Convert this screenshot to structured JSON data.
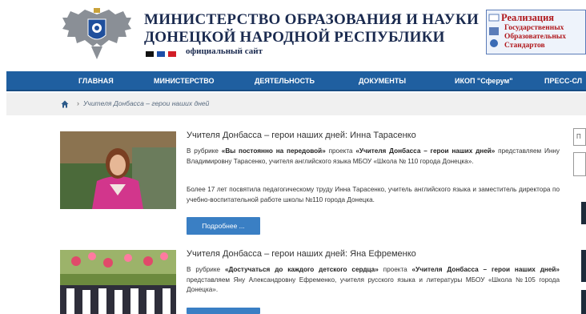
{
  "header": {
    "title_line1": "МИНИСТЕРСТВО ОБРАЗОВАНИЯ И НАУКИ",
    "title_line2": "ДОНЕЦКОЙ НАРОДНОЙ РЕСПУБЛИКИ",
    "official_site": "официальный сайт",
    "flag_colors": [
      "#111111",
      "#1d4fa8",
      "#d21e26"
    ]
  },
  "banner": {
    "heading": "Реализация",
    "line1": "Государственных",
    "line2": "Образовательных",
    "line3": "Стандартов"
  },
  "nav": {
    "items": [
      "ГЛАВНАЯ",
      "МИНИСТЕРСТВО",
      "ДЕЯТЕЛЬНОСТЬ",
      "ДОКУМЕНТЫ",
      "ИКОП \"Сферум\"",
      "ПРЕСС-СЛ"
    ],
    "color": "#1f5fa0"
  },
  "breadcrumb": {
    "separator": "›",
    "current": "Учителя Донбасса – герои наших дней"
  },
  "articles": [
    {
      "title": "Учителя Донбасса – герои наших дней: Инна Тарасенко",
      "p1_pre": "В рубрике ",
      "p1_rubric": "«Вы постоянно на передовой»",
      "p1_mid": " проекта ",
      "p1_project": "«Учителя Донбасса – герои наших дней»",
      "p1_post": " представляем Инну Владимировну Тарасенко, учителя английского языка МБОУ «Школа № 110 города Донецка».",
      "p2": "Более 17 лет посвятила педагогическому труду Инна Тарасенко, учитель английского языка и заместитель директора по учебно-воспитательной работе школы №110 города Донецка.",
      "button": "Подробнее ..."
    },
    {
      "title": "Учителя Донбасса – герои наших дней: Яна Ефременко",
      "p1_pre": "В рубрике ",
      "p1_rubric": "«Достучаться до каждого детского сердца»",
      "p1_mid": " проекта ",
      "p1_project": "«Учителя Донбасса – герои наших дней»",
      "p1_post": " представляем Яну Александровну Ефременко, учителя русского языка и литературы МБОУ «Школа №105 города Донецка».",
      "button": ""
    }
  ],
  "side": {
    "search_fragment": "П"
  }
}
